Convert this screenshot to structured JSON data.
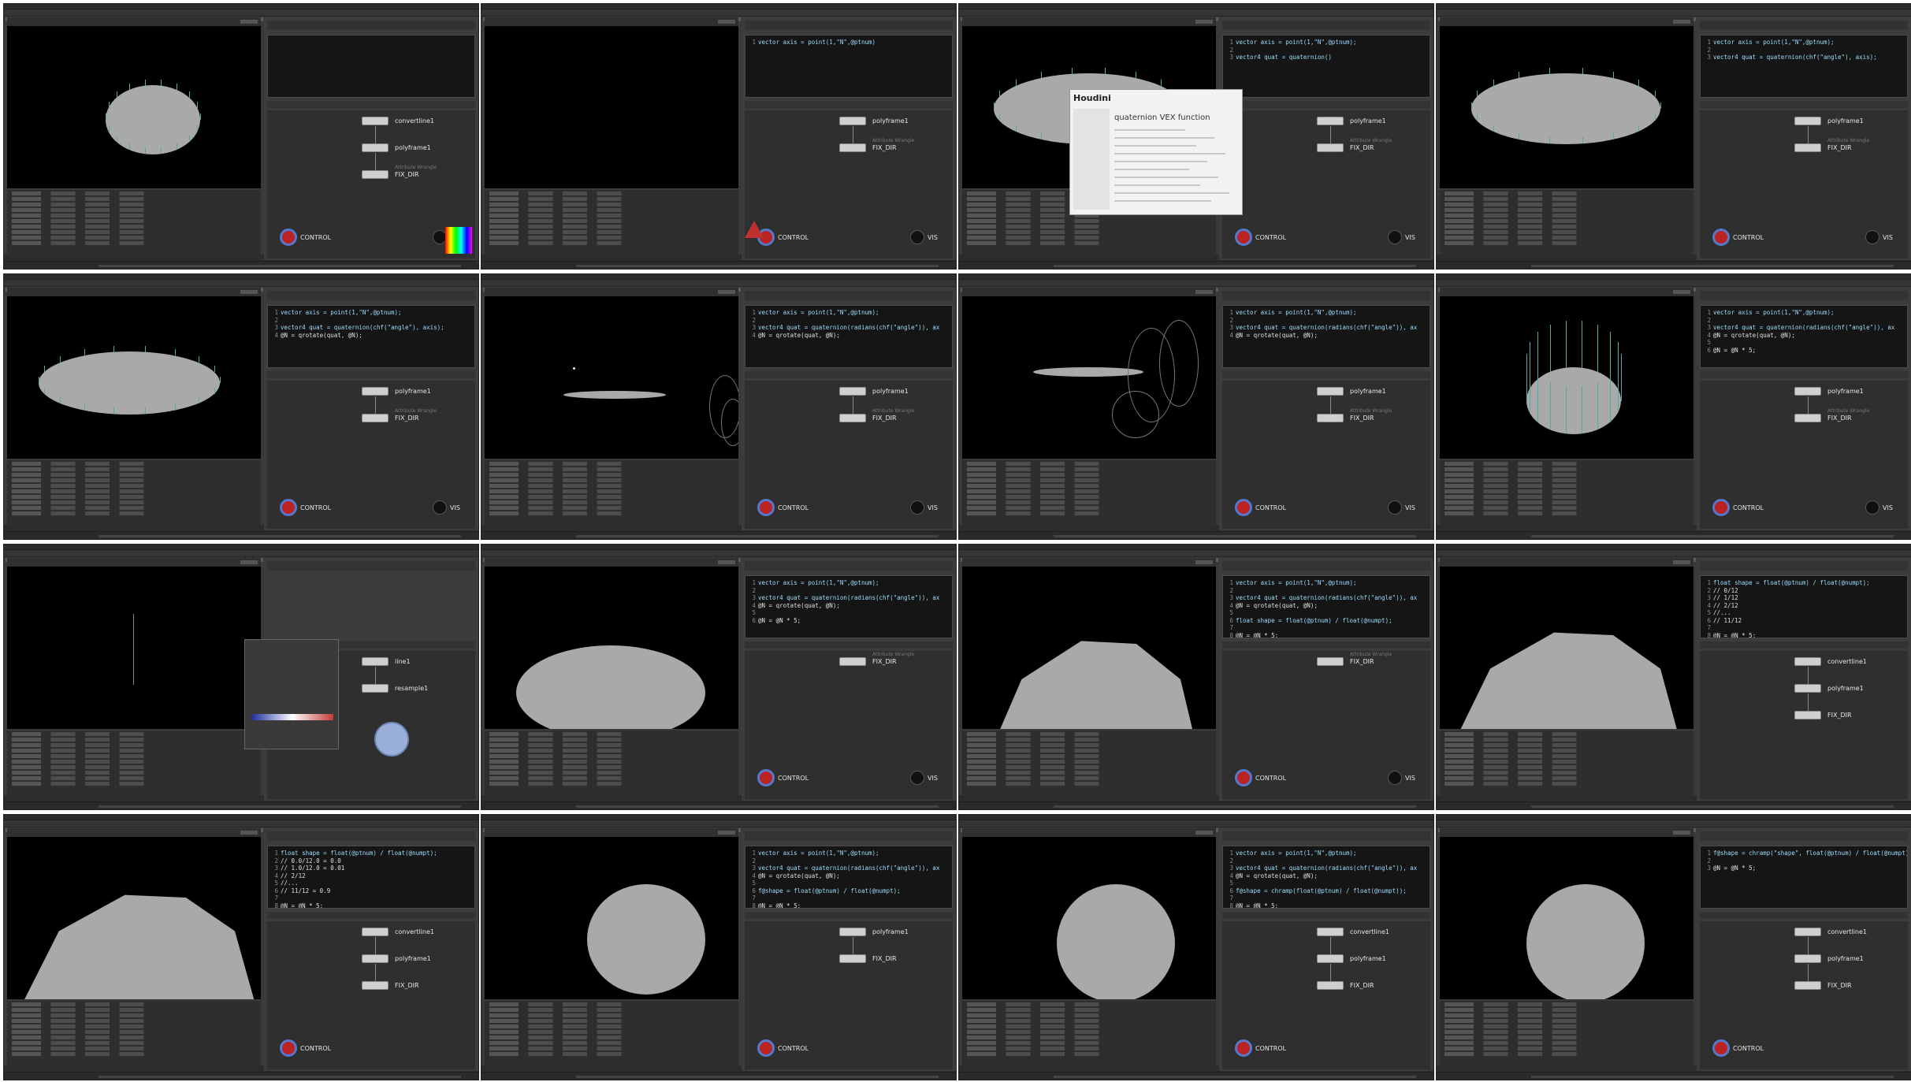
{
  "app": {
    "title": "Houdini"
  },
  "frames": [
    {
      "id": "f1",
      "code": [],
      "nodes": [
        {
          "label": "convertline1"
        },
        {
          "label": "polyframe1"
        },
        {
          "label": "FIX_DIR",
          "sub": "Attribute Wrangle"
        }
      ],
      "control": "CONTROL",
      "vis": "VIS",
      "extras": [
        "swatch"
      ]
    },
    {
      "id": "f2",
      "code": [
        "vector axis = point(1,\"N\",@ptnum)"
      ],
      "nodes": [
        {
          "label": "polyframe1"
        },
        {
          "label": "FIX_DIR",
          "sub": "Attribute Wrangle"
        }
      ],
      "control": "CONTROL",
      "vis": "VIS",
      "extras": [
        "warn"
      ]
    },
    {
      "id": "f3",
      "code": [
        "vector axis = point(1,\"N\",@ptnum);",
        "",
        "vector4 quat = quaternion()"
      ],
      "nodes": [
        {
          "label": "polyframe1"
        },
        {
          "label": "FIX_DIR",
          "sub": "Attribute Wrangle"
        }
      ],
      "control": "CONTROL",
      "vis": "VIS",
      "popup": {
        "brand": "Houdini",
        "title": "quaternion VEX function"
      }
    },
    {
      "id": "f4",
      "code": [
        "vector axis = point(1,\"N\",@ptnum);",
        "",
        "vector4 quat = quaternion(chf(\"angle\"), axis);"
      ],
      "nodes": [
        {
          "label": "polyframe1"
        },
        {
          "label": "FIX_DIR",
          "sub": "Attribute Wrangle"
        }
      ],
      "control": "CONTROL",
      "vis": "VIS"
    },
    {
      "id": "f5",
      "code": [
        "vector axis = point(1,\"N\",@ptnum);",
        "",
        "vector4 quat = quaternion(chf(\"angle\"), axis);",
        "@N = qrotate(quat, @N);"
      ],
      "nodes": [
        {
          "label": "polyframe1"
        },
        {
          "label": "FIX_DIR",
          "sub": "Attribute Wrangle"
        }
      ],
      "control": "CONTROL",
      "vis": "VIS"
    },
    {
      "id": "f6",
      "code": [
        "vector axis = point(1,\"N\",@ptnum);",
        "",
        "vector4 quat = quaternion(radians(chf(\"angle\")), ax",
        "@N = qrotate(quat, @N);"
      ],
      "nodes": [
        {
          "label": "polyframe1"
        },
        {
          "label": "FIX_DIR",
          "sub": "Attribute Wrangle"
        }
      ],
      "control": "CONTROL",
      "vis": "VIS"
    },
    {
      "id": "f7",
      "code": [
        "vector axis = point(1,\"N\",@ptnum);",
        "",
        "vector4 quat = quaternion(radians(chf(\"angle\")), ax",
        "@N = qrotate(quat, @N);"
      ],
      "nodes": [
        {
          "label": "polyframe1"
        },
        {
          "label": "FIX_DIR",
          "sub": "Attribute Wrangle"
        }
      ],
      "control": "CONTROL",
      "vis": "VIS"
    },
    {
      "id": "f8",
      "code": [
        "vector axis = point(1,\"N\",@ptnum);",
        "",
        "vector4 quat = quaternion(radians(chf(\"angle\")), ax",
        "@N = qrotate(quat, @N);",
        "",
        "@N = @N * 5;"
      ],
      "nodes": [
        {
          "label": "polyframe1"
        },
        {
          "label": "FIX_DIR",
          "sub": "Attribute Wrangle"
        }
      ],
      "control": "CONTROL",
      "vis": "VIS"
    },
    {
      "id": "f9",
      "code": [],
      "nodes": [
        {
          "label": "line1"
        },
        {
          "label": "resample1"
        }
      ],
      "control": "",
      "vis": "",
      "extras": [
        "ramp"
      ]
    },
    {
      "id": "f10",
      "code": [
        "vector axis = point(1,\"N\",@ptnum);",
        "",
        "vector4 quat = quaternion(radians(chf(\"angle\")), ax",
        "@N = qrotate(quat, @N);",
        "",
        "@N = @N * 5;"
      ],
      "nodes": [
        {
          "label": "FIX_DIR",
          "sub": "Attribute Wrangle"
        }
      ],
      "control": "CONTROL",
      "vis": "VIS"
    },
    {
      "id": "f11",
      "code": [
        "vector axis = point(1,\"N\",@ptnum);",
        "",
        "vector4 quat = quaternion(radians(chf(\"angle\")), ax",
        "@N = qrotate(quat, @N);",
        "",
        "float shape = float(@ptnum) / float(@numpt);",
        "",
        "@N = @N * 5;"
      ],
      "nodes": [
        {
          "label": "FIX_DIR",
          "sub": "Attribute Wrangle"
        }
      ],
      "control": "CONTROL",
      "vis": "VIS"
    },
    {
      "id": "f12",
      "code": [
        "float shape = float(@ptnum) / float(@numpt);",
        "// 0/12",
        "// 1/12",
        "// 2/12",
        "//...",
        "// 11/12",
        "",
        "@N = @N * 5;"
      ],
      "nodes": [
        {
          "label": "convertline1"
        },
        {
          "label": "polyframe1"
        },
        {
          "label": "FIX_DIR"
        }
      ],
      "control": "",
      "vis": ""
    },
    {
      "id": "f13",
      "code": [
        "float shape = float(@ptnum) / float(@numpt);",
        "// 0.0/12.0 = 0.0",
        "// 1.0/12.0 = 0.01",
        "// 2/12",
        "//...",
        "// 11/12 = 0.9",
        "",
        "@N = @N * 5;"
      ],
      "nodes": [
        {
          "label": "convertline1"
        },
        {
          "label": "polyframe1"
        },
        {
          "label": "FIX_DIR"
        }
      ],
      "control": "CONTROL",
      "vis": ""
    },
    {
      "id": "f14",
      "code": [
        "vector axis = point(1,\"N\",@ptnum);",
        "",
        "vector4 quat = quaternion(radians(chf(\"angle\")), ax",
        "@N = qrotate(quat, @N);",
        "",
        "f@shape = float(@ptnum) / float(@numpt);",
        "",
        "@N = @N * 5;"
      ],
      "nodes": [
        {
          "label": "polyframe1"
        },
        {
          "label": "FIX_DIR"
        }
      ],
      "control": "CONTROL",
      "vis": ""
    },
    {
      "id": "f15",
      "code": [
        "vector axis = point(1,\"N\",@ptnum);",
        "",
        "vector4 quat = quaternion(radians(chf(\"angle\")), ax",
        "@N = qrotate(quat, @N);",
        "",
        "f@shape = chramp(float(@ptnum) / float(@numpt));",
        "",
        "@N = @N * 5;"
      ],
      "nodes": [
        {
          "label": "convertline1"
        },
        {
          "label": "polyframe1"
        },
        {
          "label": "FIX_DIR"
        }
      ],
      "control": "CONTROL",
      "vis": ""
    },
    {
      "id": "f16",
      "code": [
        "f@shape = chramp(\"shape\", float(@ptnum) / float(@numpt));",
        "",
        "@N = @N * 5;"
      ],
      "nodes": [
        {
          "label": "convertline1"
        },
        {
          "label": "polyframe1"
        },
        {
          "label": "FIX_DIR"
        }
      ],
      "control": "CONTROL",
      "vis": ""
    }
  ],
  "colors": {
    "bg": "#3a3a3a",
    "viewport": "#000000",
    "geo": "#a9a9a9",
    "code_bg": "#151515",
    "control": "#b22222"
  }
}
